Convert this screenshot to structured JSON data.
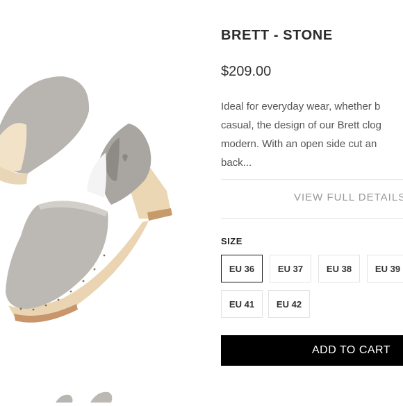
{
  "product": {
    "title": "BRETT - STONE",
    "price": "$209.00",
    "description_lines": [
      "Ideal for everyday wear, whether b",
      "casual, the design of our Brett clog",
      "modern. With an open side cut an",
      "back..."
    ],
    "view_details_label": "VIEW FULL DETAILS"
  },
  "size": {
    "label": "SIZE",
    "options": [
      "EU 36",
      "EU 37",
      "EU 38",
      "EU 39",
      "EU 41",
      "EU 42"
    ],
    "selected": "EU 36"
  },
  "cart": {
    "add_label": "ADD TO CART"
  },
  "colors": {
    "accent": "#000000",
    "suede": "#b9b6b2",
    "wood": "#ead5b4"
  }
}
